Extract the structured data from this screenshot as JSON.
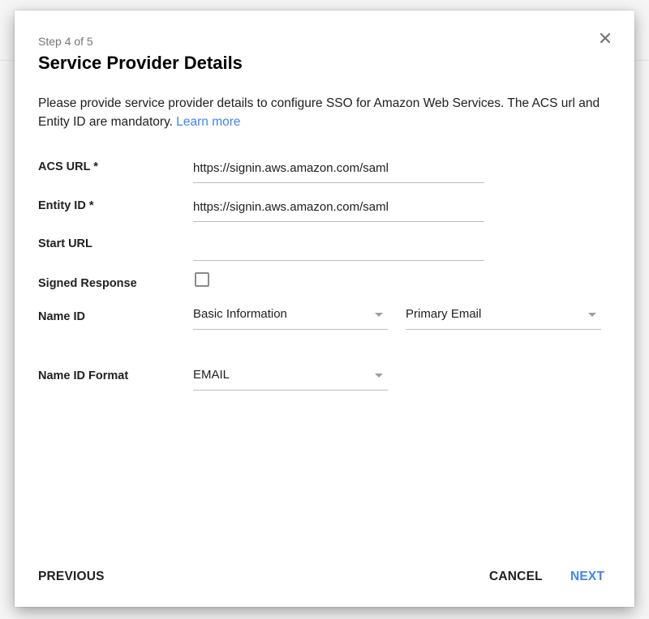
{
  "dialog": {
    "step": "Step 4 of 5",
    "title": "Service Provider Details",
    "description": "Please provide service provider details to configure SSO for Amazon Web Services. The ACS url and Entity ID are mandatory. ",
    "learn_more": "Learn more",
    "close_icon": "close-icon"
  },
  "form": {
    "acs_url": {
      "label": "ACS URL *",
      "value": "https://signin.aws.amazon.com/saml"
    },
    "entity_id": {
      "label": "Entity ID *",
      "value": "https://signin.aws.amazon.com/saml"
    },
    "start_url": {
      "label": "Start URL",
      "value": ""
    },
    "signed_response": {
      "label": "Signed Response",
      "checked": false
    },
    "name_id": {
      "label": "Name ID",
      "category": "Basic Information",
      "field": "Primary Email"
    },
    "name_id_format": {
      "label": "Name ID Format",
      "value": "EMAIL"
    }
  },
  "footer": {
    "previous": "PREVIOUS",
    "cancel": "CANCEL",
    "next": "NEXT",
    "accent_color": "#4285f4"
  }
}
